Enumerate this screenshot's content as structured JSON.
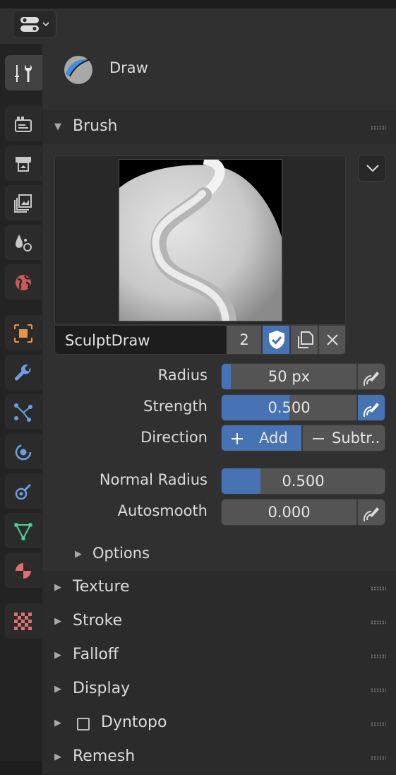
{
  "topbar": {
    "editor_type_icon": "properties-editor-icon"
  },
  "sidebar": {
    "tabs": [
      {
        "name": "tool",
        "icon": "tool-icon",
        "active": true
      },
      {
        "name": "render",
        "icon": "render-icon"
      },
      {
        "name": "output",
        "icon": "output-icon"
      },
      {
        "name": "view-layer",
        "icon": "view-layer-icon"
      },
      {
        "name": "scene",
        "icon": "scene-icon"
      },
      {
        "name": "world",
        "icon": "world-icon"
      },
      {
        "name": "object",
        "icon": "object-icon"
      },
      {
        "name": "modifiers",
        "icon": "wrench-icon"
      },
      {
        "name": "particles",
        "icon": "particles-icon"
      },
      {
        "name": "physics",
        "icon": "physics-icon"
      },
      {
        "name": "constraints",
        "icon": "constraints-icon"
      },
      {
        "name": "data",
        "icon": "mesh-data-icon"
      },
      {
        "name": "material",
        "icon": "material-icon"
      },
      {
        "name": "texture",
        "icon": "texture-icon"
      }
    ]
  },
  "header": {
    "brush_name": "Draw"
  },
  "brush": {
    "section_title": "Brush",
    "datablock_name": "SculptDraw",
    "users": "2",
    "radius_label": "Radius",
    "radius_value": "50 px",
    "radius_fraction": 0.07,
    "strength_label": "Strength",
    "strength_value": "0.500",
    "strength_fraction": 0.5,
    "direction_label": "Direction",
    "direction_add": "Add",
    "direction_subtract": "Subtr..",
    "normal_radius_label": "Normal Radius",
    "normal_radius_value": "0.500",
    "normal_radius_fraction": 0.24,
    "autosmooth_label": "Autosmooth",
    "autosmooth_value": "0.000",
    "autosmooth_fraction": 0.0,
    "options_label": "Options"
  },
  "sections": {
    "texture": "Texture",
    "stroke": "Stroke",
    "falloff": "Falloff",
    "display": "Display",
    "dyntopo": "Dyntopo",
    "remesh": "Remesh"
  },
  "colors": {
    "accent": "#4772b3",
    "panel": "#303030",
    "field": "#545454"
  }
}
